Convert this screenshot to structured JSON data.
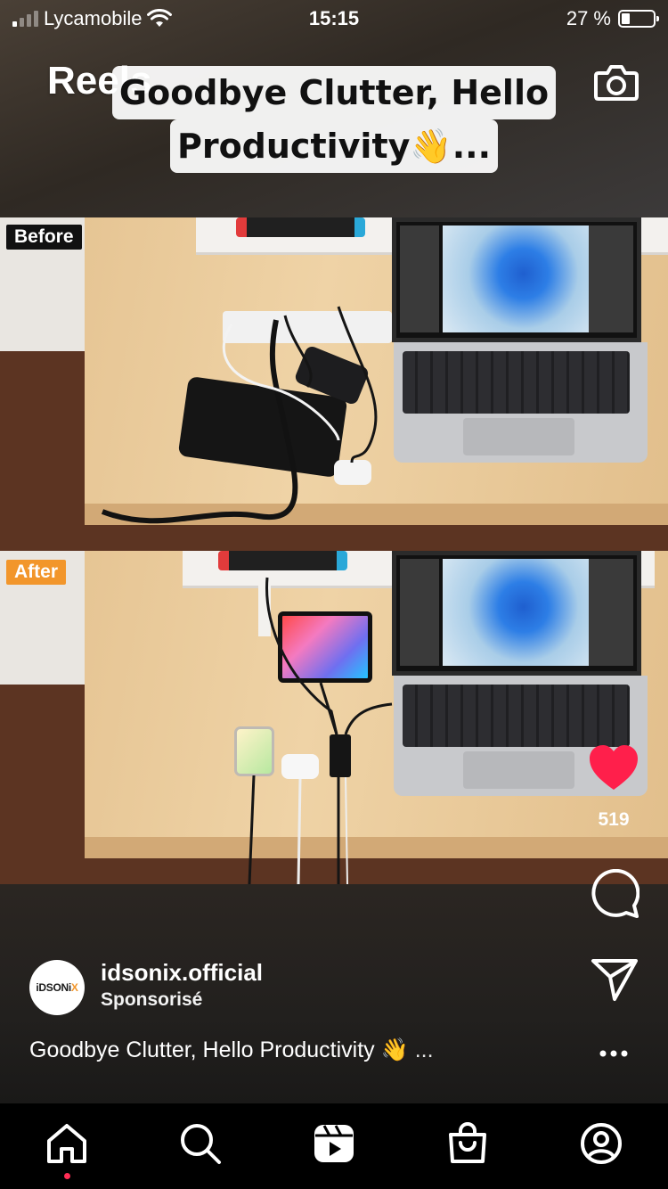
{
  "status_bar": {
    "carrier": "Lycamobile",
    "time": "15:15",
    "battery": "27 %"
  },
  "header": {
    "title": "Reels",
    "camera_icon": "camera-icon"
  },
  "video": {
    "overlay_caption_line1": "Goodbye Clutter, Hello",
    "overlay_caption_line2": "Productivity👋...",
    "before_label": "Before",
    "after_label": "After"
  },
  "actions": {
    "like_icon": "heart-icon",
    "like_color": "#ff1f4b",
    "like_count": "519",
    "comment_icon": "comment-icon",
    "share_icon": "send-icon",
    "more_icon": "more-horizontal-icon"
  },
  "account": {
    "avatar_text": "iDSONi",
    "avatar_text_accent": "X",
    "username": "idsonix.official",
    "sponsored": "Sponsorisé"
  },
  "caption": {
    "text": "Goodbye Clutter, Hello Productivity 👋",
    "more": "..."
  },
  "nav": {
    "items": [
      {
        "name": "home-icon",
        "active": true
      },
      {
        "name": "search-icon",
        "active": false
      },
      {
        "name": "reels-icon",
        "active": false
      },
      {
        "name": "shop-icon",
        "active": false
      },
      {
        "name": "profile-icon",
        "active": false
      }
    ],
    "active_dot_color": "#ff2d55"
  }
}
